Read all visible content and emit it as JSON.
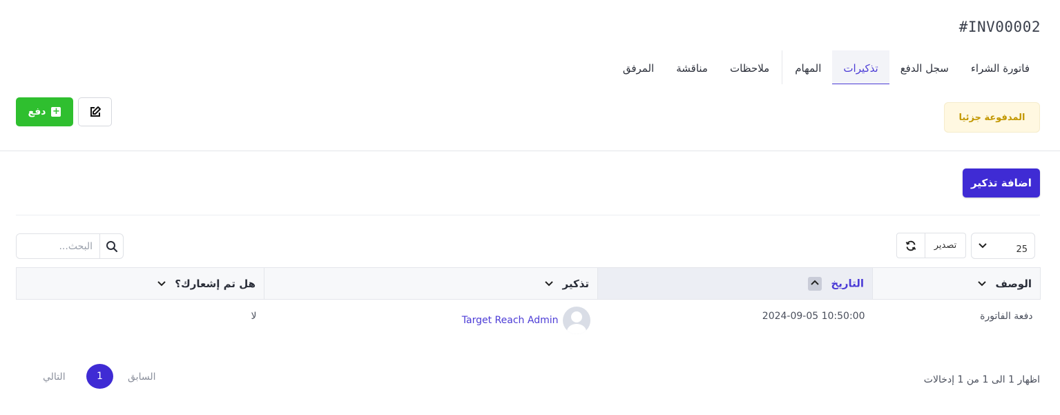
{
  "invoice": {
    "number": "#INV00002"
  },
  "tabs": [
    {
      "label": "فاتورة الشراء"
    },
    {
      "label": "سجل الدفع"
    },
    {
      "label": "تذكيرات"
    },
    {
      "label": "المهام"
    },
    {
      "label": "ملاحظات"
    },
    {
      "label": "مناقشة"
    },
    {
      "label": "المرفق"
    }
  ],
  "active_tab": "تذكيرات",
  "status": {
    "label": "المدفوعة جزئيا",
    "color": "#c29700"
  },
  "actions": {
    "pay_label": "دفع",
    "add_reminder_label": "اضافة تذكير"
  },
  "toolbar": {
    "page_size": "25",
    "export_label": "تصدير",
    "search_placeholder": "البحث..."
  },
  "table": {
    "columns": {
      "description": "الوصف",
      "date": "التاريخ",
      "reminder": "تذكير",
      "notified": "هل تم إشعارك؟"
    },
    "rows": [
      {
        "description": "دفعة الفاتورة",
        "date": "2024-09-05 10:50:00",
        "reminder": "Target Reach Admin",
        "notified": "لا"
      }
    ]
  },
  "pagination": {
    "info": "اظهار 1 الى 1 من 1 إدخالات",
    "prev_label": "السابق",
    "current_page": "1",
    "next_label": "التالي"
  },
  "colors": {
    "accent": "#3f2bd4",
    "success": "#2fbf2f",
    "warning_bg": "#fff8e1"
  }
}
